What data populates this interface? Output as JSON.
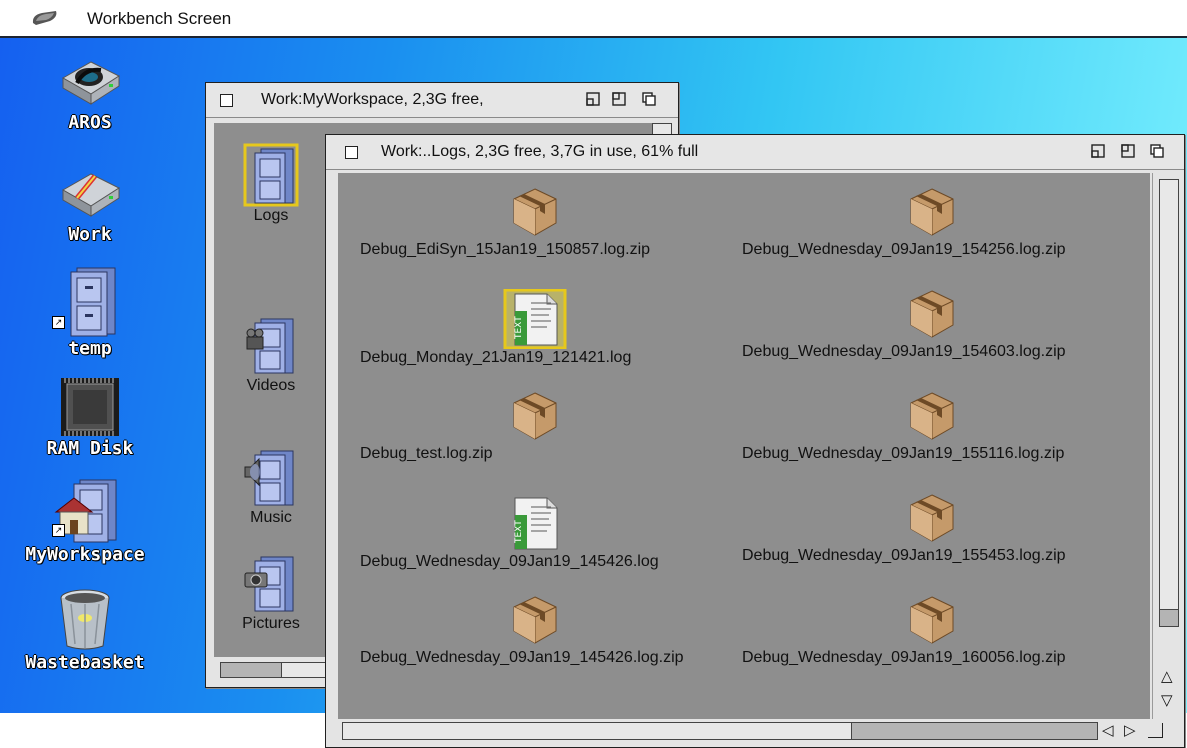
{
  "menubar": {
    "title": "Workbench Screen"
  },
  "desktop": {
    "icons": [
      {
        "label": "AROS"
      },
      {
        "label": "Work"
      },
      {
        "label": "temp"
      },
      {
        "label": "RAM Disk"
      },
      {
        "label": "MyWorkspace"
      },
      {
        "label": "Wastebasket"
      }
    ]
  },
  "workspace_window": {
    "title": "Work:MyWorkspace,  2,3G free,",
    "items": [
      {
        "label": "Logs"
      },
      {
        "label": "Videos"
      },
      {
        "label": "Music"
      },
      {
        "label": "Pictures"
      }
    ]
  },
  "logs_window": {
    "title": "Work:..Logs,  2,3G free, 3,7G in use, 61% full",
    "files": [
      {
        "label": "Debug_EdiSyn_15Jan19_150857.log.zip",
        "type": "zip"
      },
      {
        "label": "Debug_Wednesday_09Jan19_154256.log.zip",
        "type": "zip"
      },
      {
        "label": "Debug_Monday_21Jan19_121421.log",
        "type": "text"
      },
      {
        "label": "Debug_Wednesday_09Jan19_154603.log.zip",
        "type": "zip"
      },
      {
        "label": "Debug_test.log.zip",
        "type": "zip"
      },
      {
        "label": "Debug_Wednesday_09Jan19_155116.log.zip",
        "type": "zip"
      },
      {
        "label": "Debug_Wednesday_09Jan19_145426.log",
        "type": "text"
      },
      {
        "label": "Debug_Wednesday_09Jan19_155453.log.zip",
        "type": "zip"
      },
      {
        "label": "Debug_Wednesday_09Jan19_145426.log.zip",
        "type": "zip"
      },
      {
        "label": "Debug_Wednesday_09Jan19_160056.log.zip",
        "type": "zip"
      }
    ],
    "text_icon_badge": "TEXT"
  },
  "colors": {
    "desktop_from": "#1560f0",
    "desktop_to": "#7ff3ff",
    "window_content": "#8e8e8e",
    "window_frame": "#e4e4e4"
  },
  "icons": [
    "amiga-logo-icon",
    "drive-icon",
    "cabinet-icon",
    "chip-icon",
    "wastebasket-icon",
    "package-icon",
    "text-file-icon",
    "close-icon",
    "zoom-icon",
    "depth-icon"
  ]
}
